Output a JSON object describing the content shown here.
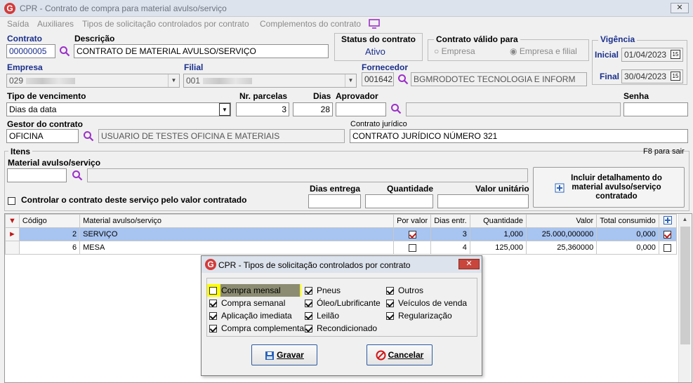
{
  "window": {
    "title": "CPR - Contrato de compra para material avulso/serviço",
    "close": "✕"
  },
  "menu": [
    "Saída",
    "Auxiliares",
    "Tipos de solicitação controlados por contrato",
    "Complementos do contrato"
  ],
  "contrato": {
    "label": "Contrato",
    "value": "00000005"
  },
  "descricao": {
    "label": "Descrição",
    "value": "CONTRATO DE MATERIAL AVULSO/SERVIÇO"
  },
  "status": {
    "label": "Status do contrato",
    "value": "Ativo"
  },
  "valido": {
    "label": "Contrato válido para",
    "opt1": "Empresa",
    "opt2": "Empresa e filial"
  },
  "vigencia": {
    "label": "Vigência",
    "inicial_label": "Inicial",
    "inicial": "01/04/2023",
    "final_label": "Final",
    "final": "30/04/2023"
  },
  "empresa": {
    "label": "Empresa",
    "value": "029"
  },
  "filial": {
    "label": "Filial",
    "value": "001"
  },
  "fornecedor": {
    "label": "Fornecedor",
    "code": "001642",
    "name": "BGMRODOTEC TECNOLOGIA E INFORM"
  },
  "vencimento": {
    "label": "Tipo de vencimento",
    "value": "Dias da data"
  },
  "parcelas": {
    "label": "Nr. parcelas",
    "value": "3"
  },
  "dias": {
    "label": "Dias",
    "value": "28"
  },
  "aprovador": {
    "label": "Aprovador"
  },
  "senha": {
    "label": "Senha"
  },
  "gestor": {
    "label": "Gestor do contrato",
    "code": "OFICINA",
    "name": "USUARIO DE TESTES OFICINA E MATERIAIS"
  },
  "juridico": {
    "label": "Contrato jurídico",
    "value": "CONTRATO JURÍDICO NÚMERO 321"
  },
  "itens": {
    "label": "Itens",
    "hint": "F8 para sair",
    "material_label": "Material avulso/serviço",
    "controlar_label": "Controlar o contrato deste serviço pelo valor contratado",
    "dias_entrega": "Dias entrega",
    "quantidade": "Quantidade",
    "valor_unitario": "Valor unitário",
    "incluir_btn": "Incluir detalhamento do material avulso/serviço contratado"
  },
  "grid": {
    "headers": [
      "Código",
      "Material avulso/serviço",
      "Por valor",
      "Dias entr.",
      "Quantidade",
      "Valor",
      "Total consumido"
    ],
    "rows": [
      {
        "codigo": "2",
        "material": "SERVIÇO",
        "por_valor": true,
        "dias": "3",
        "quantidade": "1,000",
        "valor": "25.000,000000",
        "total": "0,000",
        "check": true
      },
      {
        "codigo": "6",
        "material": "MESA",
        "por_valor": false,
        "dias": "4",
        "quantidade": "125,000",
        "valor": "25,360000",
        "total": "0,000",
        "check": false
      }
    ]
  },
  "dialog": {
    "title": "CPR - Tipos de solicitação controlados por contrato",
    "col1": [
      {
        "label": "Compra mensal",
        "checked": false
      },
      {
        "label": "Compra semanal",
        "checked": true
      },
      {
        "label": "Aplicação imediata",
        "checked": true
      },
      {
        "label": "Compra complementar",
        "checked": true
      }
    ],
    "col2": [
      {
        "label": "Pneus",
        "checked": true
      },
      {
        "label": "Óleo/Lubrificante",
        "checked": true
      },
      {
        "label": "Leilão",
        "checked": true
      },
      {
        "label": "Recondicionado",
        "checked": true
      }
    ],
    "col3": [
      {
        "label": "Outros",
        "checked": true
      },
      {
        "label": "Veículos de venda",
        "checked": true
      },
      {
        "label": "Regularização",
        "checked": true
      }
    ],
    "gravar": "Gravar",
    "cancelar": "Cancelar"
  },
  "colors": {
    "accent": "#1a2f8c",
    "highlight": "#ffff00",
    "selection": "#a8c4f0",
    "titlebar": "#dde3ec"
  }
}
